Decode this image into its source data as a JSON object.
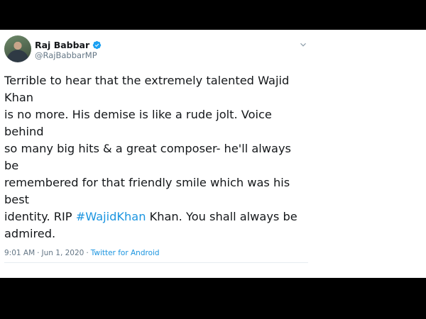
{
  "tweet": {
    "author_name": "Raj Babbar",
    "handle": "@RajBabbarMP",
    "text_part1": "Terrible to hear that the extremely talented Wajid Khan\nis no more. His demise is like a rude jolt. Voice behind\nso many big hits & a great composer- he'll always be\nremembered for that friendly smile which was his best\nidentity. RIP ",
    "hashtag": "#WajidKhan",
    "text_part2": " Khan. You shall always be\nadmired.",
    "time": "9:01 AM",
    "date_separator": "·",
    "date": "Jun 1, 2020",
    "source_separator": "·",
    "source": "Twitter for Android"
  },
  "colors": {
    "link": "#1b95e0",
    "verified": "#1da1f2",
    "muted": "#657786",
    "text": "#14171a",
    "letterbox": "#000000"
  },
  "icons": {
    "verified": "verified-badge-icon",
    "menu": "chevron-down-icon"
  }
}
